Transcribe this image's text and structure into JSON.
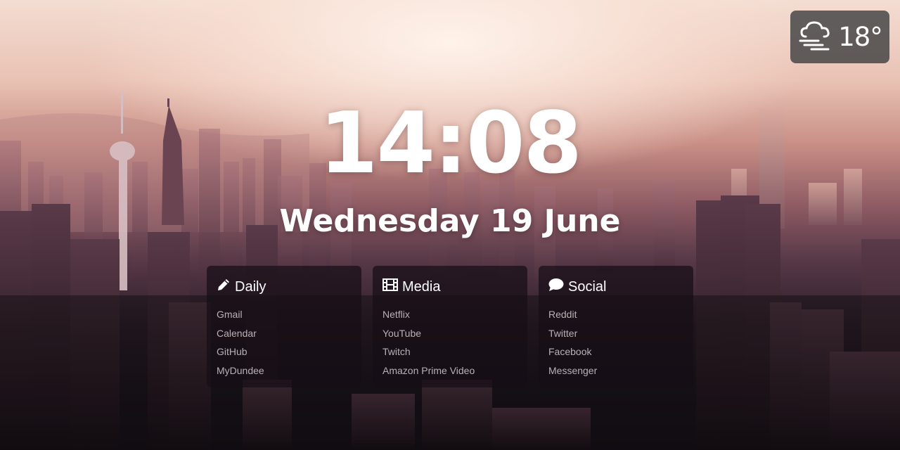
{
  "weather": {
    "temperature": "18°",
    "icon": "cloud-wind-rain-icon"
  },
  "clock": {
    "time": "14:08",
    "date": "Wednesday 19 June"
  },
  "panels": [
    {
      "title": "Daily",
      "icon": "pencil-icon",
      "links": [
        "Gmail",
        "Calendar",
        "GitHub",
        "MyDundee"
      ]
    },
    {
      "title": "Media",
      "icon": "film-icon",
      "links": [
        "Netflix",
        "YouTube",
        "Twitch",
        "Amazon Prime Video"
      ]
    },
    {
      "title": "Social",
      "icon": "chat-bubble-icon",
      "links": [
        "Reddit",
        "Twitter",
        "Facebook",
        "Messenger"
      ]
    }
  ],
  "colors": {
    "text": "#ffffff",
    "link": "#b7b2b7",
    "panel_bg": "#160e16",
    "weather_bg": "#464646"
  }
}
